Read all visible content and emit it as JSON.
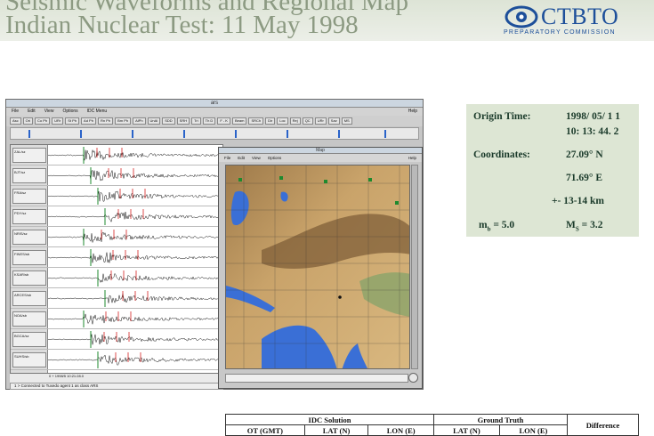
{
  "slide": {
    "title_line1": "Seismic Waveforms and Regional Map",
    "title_line2": "Indian Nuclear Test:  11 May 1998"
  },
  "logo": {
    "name": "CTBTO",
    "subtitle": "PREPARATORY COMMISSION",
    "icon": "ctbto-eye-icon",
    "color": "#1d4f9a"
  },
  "ars_window": {
    "menu": [
      "File",
      "Edit",
      "View",
      "Options",
      "IDC Menu"
    ],
    "help": "Help",
    "toolbar": [
      "Asc",
      "Ori",
      "Co Ph",
      "URr",
      "St Ph",
      "Ad Ph",
      "Rn Ph",
      "Bm Ph",
      "AlPh",
      "UnAl",
      "SDD",
      "SRH",
      "Tri",
      "Th D",
      "F - K",
      "Beam",
      "SRCh",
      "Dir",
      "Loc",
      "Rej",
      "QC",
      "URr",
      "Sav",
      "MS"
    ],
    "stations": [
      "ZAL/sz",
      "BJT/sz",
      "FRA/sz",
      "PDY/sz",
      "NRIS/sz",
      "FINES/sb",
      "KSAR/sb",
      "ARCES/sb",
      "NOA/sb",
      "BGCA/sz",
      "SUHS/sb"
    ],
    "time_readout": "0 + 1998/5 10:21:28.0",
    "status": "1 > Connected to Tuxedo agent 1 as class ARS"
  },
  "map_window": {
    "title": "Map",
    "menu": [
      "File",
      "Edit",
      "View",
      "Options"
    ],
    "help": "Help"
  },
  "info": {
    "origin_time_label": "Origin Time:",
    "origin_date": "1998/ 05/ 1 1",
    "origin_time": "10: 13: 44. 2",
    "coordinates_label": "Coordinates:",
    "lat": "27.09° N",
    "lon": "71.69° E",
    "depth": "+- 13-14 km",
    "mb_label": "m",
    "mb_sub": "b",
    "mb_value": " = 5.0",
    "ms_label": "M",
    "ms_sub": "S",
    "ms_value": " = 3.2"
  },
  "table": {
    "idc_header": "IDC Solution",
    "gt_header": "Ground Truth",
    "diff_header": "Difference",
    "columns": [
      "OT (GMT)",
      "LAT (N)",
      "LON (E)",
      "LAT (N)",
      "LON (E)"
    ]
  },
  "colors": {
    "title_text": "#8c9a82",
    "info_bg": "#dde6d4",
    "map_sea": "#3a6fd6",
    "map_land": "#c49a5a"
  }
}
